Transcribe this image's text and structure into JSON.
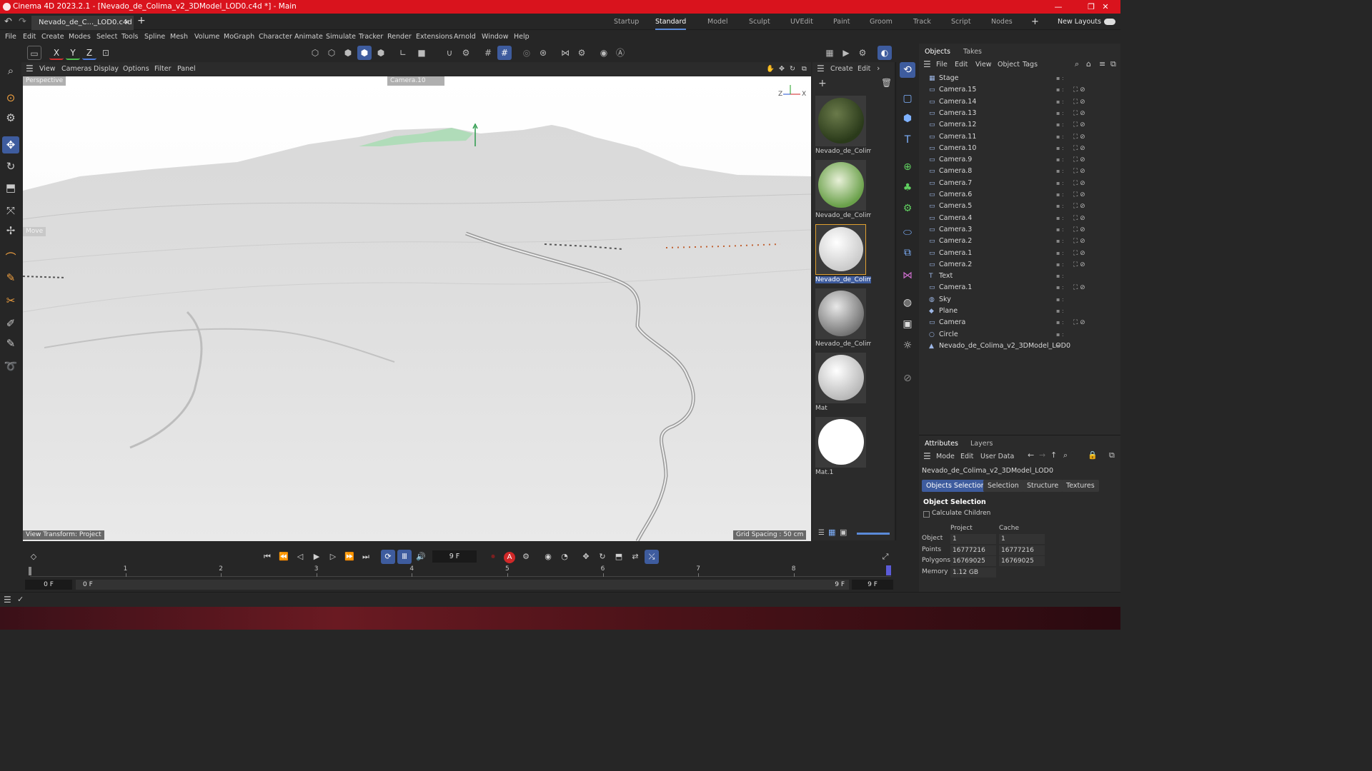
{
  "window": {
    "title": "Cinema 4D 2023.2.1 - [Nevado_de_Colima_v2_3DModel_LOD0.c4d *] - Main",
    "controls": [
      "—",
      "❐",
      "✕"
    ]
  },
  "tabs": {
    "document": "Nevado_de_C..._LOD0.c4d *",
    "close": "✕",
    "add": "+",
    "layouts": [
      "Startup",
      "Standard",
      "Model",
      "Sculpt",
      "UVEdit",
      "Paint",
      "Groom",
      "Track",
      "Script",
      "Nodes"
    ],
    "active_layout": "Standard",
    "new_layouts": "New Layouts"
  },
  "menu": [
    "File",
    "Edit",
    "Create",
    "Modes",
    "Select",
    "Tools",
    "Spline",
    "Mesh",
    "Volume",
    "MoGraph",
    "Character",
    "Animate",
    "Simulate",
    "Tracker",
    "Render",
    "Extensions",
    "Arnold",
    "Window",
    "Help"
  ],
  "toolbar": {
    "axis": [
      "X",
      "Y",
      "Z"
    ]
  },
  "viewport": {
    "menu": [
      "View",
      "Cameras",
      "Display",
      "Options",
      "Filter",
      "Panel"
    ],
    "label": "Perspective",
    "camera": "Camera.10",
    "move_hud": "Move",
    "view_transform": "View Transform: Project",
    "grid_spacing": "Grid Spacing : 50 cm",
    "axis_z": "Z",
    "axis_x": "X"
  },
  "materials": {
    "menu": [
      "Create",
      "Edit"
    ],
    "items": [
      {
        "name": "Nevado_de_Colim",
        "selected": false
      },
      {
        "name": "Nevado_de_Colim",
        "selected": false
      },
      {
        "name": "Nevado_de_Colim",
        "selected": true
      },
      {
        "name": "Nevado_de_Colim",
        "selected": false
      },
      {
        "name": "Mat",
        "selected": false
      },
      {
        "name": "Mat.1",
        "selected": false
      }
    ]
  },
  "objects": {
    "tabs": [
      "Objects",
      "Takes"
    ],
    "menu": [
      "File",
      "Edit",
      "View",
      "Object",
      "Tags"
    ],
    "rows": [
      "Stage",
      "Camera.15",
      "Camera.14",
      "Camera.13",
      "Camera.12",
      "Camera.11",
      "Camera.10",
      "Camera.9",
      "Camera.8",
      "Camera.7",
      "Camera.6",
      "Camera.5",
      "Camera.4",
      "Camera.3",
      "Camera.2",
      "Camera.1",
      "Camera.2",
      "Text",
      "Camera.1",
      "Sky",
      "Plane",
      "Camera",
      "Circle",
      "Nevado_de_Colima_v2_3DModel_LOD0"
    ]
  },
  "attributes": {
    "tabs": [
      "Attributes",
      "Layers"
    ],
    "menu": [
      "Mode",
      "Edit",
      "User Data"
    ],
    "object_name": "Nevado_de_Colima_v2_3DModel_LOD0",
    "buttons": [
      "Objects Selection",
      "Selection",
      "Structure",
      "Textures"
    ],
    "section": "Object Selection",
    "checkbox": "Calculate Children",
    "col_project": "Project",
    "col_cache": "Cache",
    "stats": [
      {
        "label": "Object",
        "project": "1",
        "cache": "1"
      },
      {
        "label": "Points",
        "project": "16777216",
        "cache": "16777216"
      },
      {
        "label": "Polygons",
        "project": "16769025",
        "cache": "16769025"
      },
      {
        "label": "Memory",
        "project": "1.12 GB",
        "cache": ""
      }
    ]
  },
  "timeline": {
    "current_frame": "9 F",
    "ruler": [
      "1",
      "2",
      "3",
      "4",
      "5",
      "6",
      "7",
      "8"
    ],
    "start": "0 F",
    "start2": "0 F",
    "end": "9 F",
    "end2": "9 F"
  },
  "colors": {
    "titlebar": "#d9131d",
    "accent": "#3e5c9e",
    "panel": "#2b2b2b",
    "background": "#262626"
  }
}
